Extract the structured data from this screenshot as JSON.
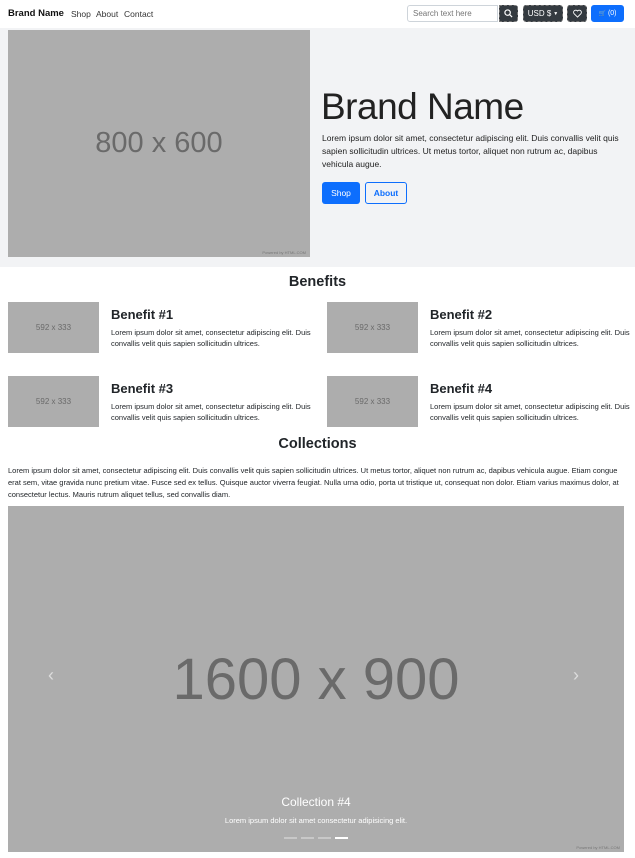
{
  "navbar": {
    "brand": "Brand Name",
    "links": [
      "Shop",
      "About",
      "Contact"
    ],
    "search_placeholder": "Search text here",
    "currency": "USD $",
    "cart_label": "(0)"
  },
  "hero": {
    "image_label": "800 x 600",
    "image_credit": "Powered by HTML.COM",
    "title": "Brand Name",
    "text": "Lorem ipsum dolor sit amet, consectetur adipiscing elit. Duis convallis velit quis sapien sollicitudin ultrices. Ut metus tortor, aliquet non rutrum ac, dapibus vehicula augue.",
    "shop_button": "Shop",
    "about_button": "About"
  },
  "benefits": {
    "title": "Benefits",
    "items": [
      {
        "image_label": "592 x 333",
        "title": "Benefit #1",
        "text": "Lorem ipsum dolor sit amet, consectetur adipiscing elit. Duis convallis velit quis sapien sollicitudin ultrices."
      },
      {
        "image_label": "592 x 333",
        "title": "Benefit #2",
        "text": "Lorem ipsum dolor sit amet, consectetur adipiscing elit. Duis convallis velit quis sapien sollicitudin ultrices."
      },
      {
        "image_label": "592 x 333",
        "title": "Benefit #3",
        "text": "Lorem ipsum dolor sit amet, consectetur adipiscing elit. Duis convallis velit quis sapien sollicitudin ultrices."
      },
      {
        "image_label": "592 x 333",
        "title": "Benefit #4",
        "text": "Lorem ipsum dolor sit amet, consectetur adipiscing elit. Duis convallis velit quis sapien sollicitudin ultrices."
      }
    ]
  },
  "collections": {
    "title": "Collections",
    "text": "Lorem ipsum dolor sit amet, consectetur adipiscing elit. Duis convallis velit quis sapien sollicitudin ultrices. Ut metus tortor, aliquet non rutrum ac, dapibus vehicula augue. Etiam congue erat sem, vitae gravida nunc pretium vitae. Fusce sed ex tellus. Quisque auctor viverra feugiat. Nulla urna odio, porta ut tristique ut, consequat non dolor. Etiam varius maximus dolor, at consectetur lectus. Mauris rutrum aliquet tellus, sed convallis diam.",
    "carousel": {
      "image_label": "1600 x 900",
      "image_credit": "Powered by HTML.COM",
      "caption_title": "Collection #4",
      "caption_text": "Lorem ipsum dolor sit amet consectetur adipisicing elit.",
      "prev_glyph": "‹",
      "next_glyph": "›",
      "slide_count": 4,
      "active_slide": 4
    }
  },
  "colors": {
    "primary": "#0d6efd",
    "dark": "#343a40",
    "placeholder": "#adadad",
    "hero_bg": "#f2f3f5"
  }
}
